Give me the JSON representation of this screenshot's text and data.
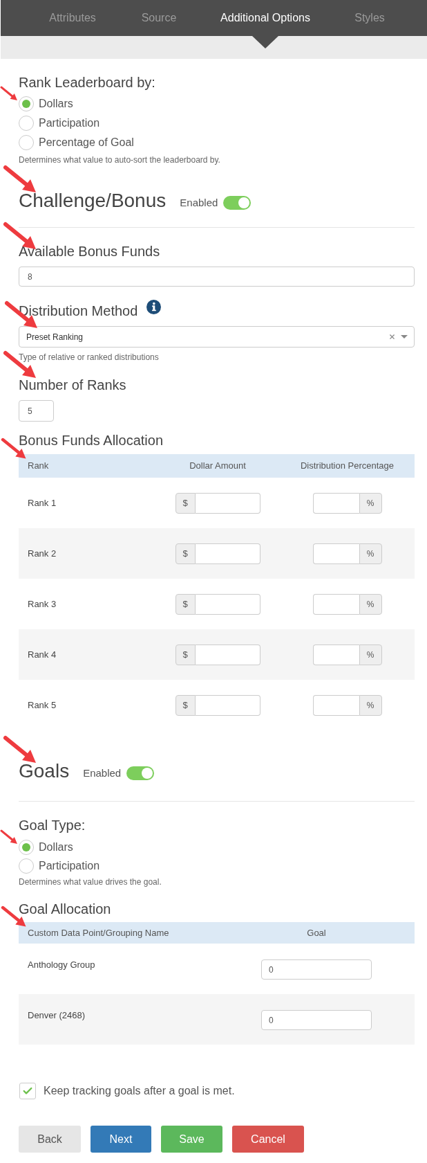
{
  "tabs": [
    {
      "label": "Attributes",
      "selected": false
    },
    {
      "label": "Source",
      "selected": false
    },
    {
      "label": "Additional Options",
      "selected": true
    },
    {
      "label": "Styles",
      "selected": false
    }
  ],
  "rank_leaderboard": {
    "title": "Rank Leaderboard by:",
    "options": [
      {
        "label": "Dollars",
        "selected": true
      },
      {
        "label": "Participation",
        "selected": false
      },
      {
        "label": "Percentage of Goal",
        "selected": false
      }
    ],
    "help": "Determines what value to auto-sort the leaderboard by."
  },
  "challenge_bonus": {
    "title": "Challenge/Bonus",
    "toggle_label": "Enabled",
    "on": true,
    "available_bonus_funds": {
      "label": "Available Bonus Funds",
      "value": "8"
    },
    "distribution_method": {
      "label": "Distribution Method",
      "value": "Preset Ranking",
      "help": "Type of relative or ranked distributions"
    },
    "number_of_ranks": {
      "label": "Number of Ranks",
      "value": "5"
    },
    "allocation": {
      "title": "Bonus Funds Allocation",
      "columns": [
        "Rank",
        "Dollar Amount",
        "Distribution Percentage"
      ],
      "rows": [
        {
          "rank": "Rank 1",
          "dollar_prefix": "$",
          "percent_suffix": "%"
        },
        {
          "rank": "Rank 2",
          "dollar_prefix": "$",
          "percent_suffix": "%"
        },
        {
          "rank": "Rank 3",
          "dollar_prefix": "$",
          "percent_suffix": "%"
        },
        {
          "rank": "Rank 4",
          "dollar_prefix": "$",
          "percent_suffix": "%"
        },
        {
          "rank": "Rank 5",
          "dollar_prefix": "$",
          "percent_suffix": "%"
        }
      ]
    }
  },
  "goals": {
    "title": "Goals",
    "toggle_label": "Enabled",
    "on": true,
    "goal_type": {
      "label": "Goal Type:",
      "options": [
        {
          "label": "Dollars",
          "selected": true
        },
        {
          "label": "Participation",
          "selected": false
        }
      ],
      "help": "Determines what value drives the goal."
    },
    "allocation": {
      "title": "Goal Allocation",
      "columns": [
        "Custom Data Point/Grouping Name",
        "Goal"
      ],
      "rows": [
        {
          "name": "Anthology Group",
          "goal": "0"
        },
        {
          "name": "Denver (2468)",
          "goal": "0"
        }
      ]
    }
  },
  "keep_tracking": {
    "label": "Keep tracking goals after a goal is met.",
    "checked": true
  },
  "buttons": [
    {
      "label": "Back",
      "kind": "default"
    },
    {
      "label": "Next",
      "kind": "primary"
    },
    {
      "label": "Save",
      "kind": "success"
    },
    {
      "label": "Cancel",
      "kind": "danger"
    }
  ]
}
